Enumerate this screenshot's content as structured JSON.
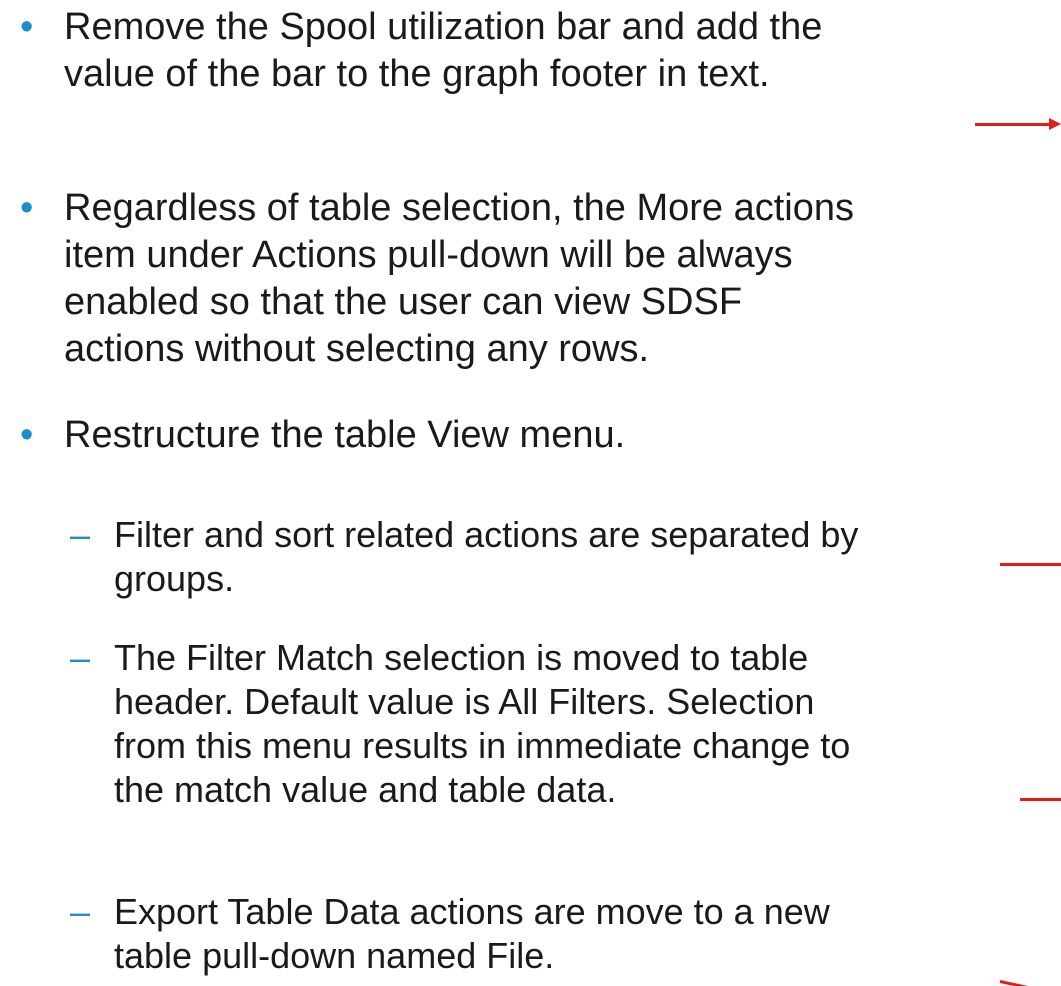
{
  "bullets": [
    {
      "symbol": "•",
      "text": "Remove the Spool utilization bar and add the\nvalue of the bar to the graph footer in text."
    },
    {
      "symbol": "•",
      "text": "Regardless of table selection, the More actions\nitem under Actions pull-down will be always\nenabled so that the user can view SDSF\nactions without selecting any rows."
    },
    {
      "symbol": "•",
      "text": "Restructure the table View menu."
    }
  ],
  "sub_bullets": [
    {
      "symbol": "–",
      "text": "Filter and sort related actions are separated by\ngroups."
    },
    {
      "symbol": "–",
      "text": "The Filter Match selection is moved to table\nheader. Default value is All Filters. Selection\nfrom this menu results in immediate change to\nthe match value and table data."
    },
    {
      "symbol": "–",
      "text": "Export Table Data actions are move to a new\ntable pull-down named File."
    }
  ],
  "colors": {
    "bullet": "#1a8fc9",
    "text": "#1a1a1a",
    "marker": "#e31b1b"
  }
}
